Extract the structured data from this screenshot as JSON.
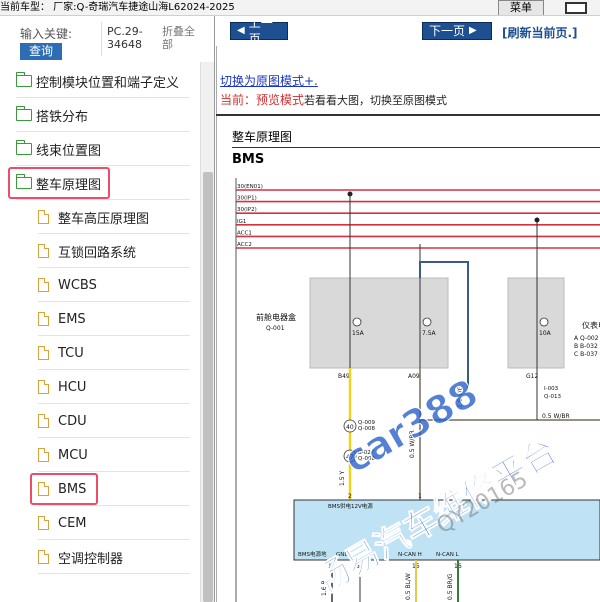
{
  "topbar": {
    "vehicle": "当前车型：  厂家:Q-奇瑞汽车捷途山海L62024-2025",
    "menu_label": "菜单"
  },
  "search": {
    "label": "输入关键:",
    "query_button": "查询",
    "code": "PC.29-34648",
    "collapse": "折叠全部"
  },
  "tree": [
    {
      "label": "控制模块位置和端子定义",
      "type": "folder"
    },
    {
      "label": "搭铁分布",
      "type": "folder"
    },
    {
      "label": "线束位置图",
      "type": "folder"
    },
    {
      "label": "整车原理图",
      "type": "folder",
      "highlight": true
    },
    {
      "label": "整车高压原理图",
      "type": "file"
    },
    {
      "label": "互锁回路系统",
      "type": "file"
    },
    {
      "label": "WCBS",
      "type": "file"
    },
    {
      "label": "EMS",
      "type": "file"
    },
    {
      "label": "TCU",
      "type": "file"
    },
    {
      "label": "HCU",
      "type": "file"
    },
    {
      "label": "CDU",
      "type": "file"
    },
    {
      "label": "MCU",
      "type": "file"
    },
    {
      "label": "BMS",
      "type": "file",
      "highlight": true
    },
    {
      "label": "CEM",
      "type": "file"
    },
    {
      "label": "空调控制器",
      "type": "file"
    }
  ],
  "nav": {
    "prev": "上一页",
    "next": "下一页",
    "refresh": "[刷新当前页.]",
    "mode_switch": "切换为原图模式+.",
    "current_prefix": "当前：",
    "current_mode": "预览模式",
    "current_hint": "若看看大图，切换至原图模式"
  },
  "diagram": {
    "section_title": "整车原理图",
    "system": "BMS",
    "power_lines": [
      "30(EN01)",
      "30(IP1)",
      "30(IP2)",
      "IG1",
      "ACC1",
      "ACC2"
    ],
    "front_box": "前舱电器盒",
    "front_box_code": "Q-001",
    "fuses": [
      {
        "id": "F1",
        "rating": "15A"
      },
      {
        "id": "F2",
        "rating": "7.5A"
      },
      {
        "id": "F3",
        "rating": "10A"
      }
    ],
    "instrument_box": "仪表电器盒",
    "instrument_codes": [
      "A Q-002",
      "B B-032",
      "C B-037"
    ],
    "pins": [
      "B49",
      "A09",
      "G12"
    ],
    "pin_codes": [
      "Q-008",
      "B-027",
      "I-003",
      "Q-013",
      "Q-009",
      "Q-008"
    ],
    "splice_1": "40",
    "splice_2": "47",
    "wire_1": "1.5 Y",
    "wire_2": "0.5 W/BR",
    "wire_3": "1.6 V/G",
    "wire_4": "0.5 W/BR",
    "module_labels": [
      "BMS供电12V电源",
      "BMS电源地",
      "GND",
      "N-CAN H",
      "N-CAN L"
    ],
    "module_pins": [
      "2",
      "1",
      "14",
      "8",
      "15",
      "16"
    ],
    "bottom_wires": [
      "1.6 B",
      "0.5 BL/W",
      "0.5 BR/G"
    ]
  },
  "colors": {
    "nav_blue": "#1d4f91",
    "red_line": "#d93040",
    "yellow_wire": "#f1d21c",
    "highlight": "#ee4d6a",
    "watermark": "#2a60c8"
  },
  "watermark": {
    "text_main": "car388",
    "text_cn": "畅易汽车维修平台",
    "text_id": "QY20165"
  }
}
